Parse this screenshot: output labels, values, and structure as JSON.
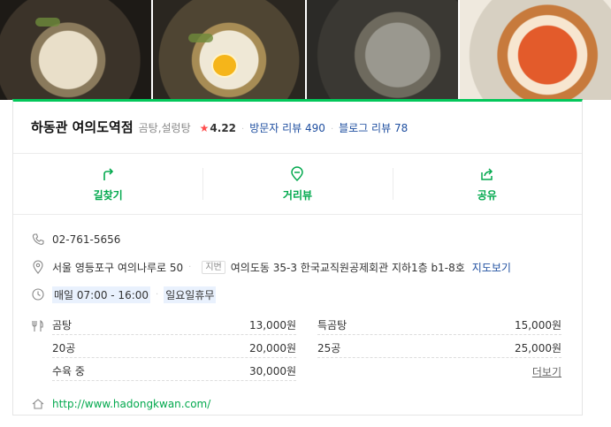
{
  "photos": [
    "food-photo-1",
    "food-photo-2",
    "food-photo-3",
    "food-photo-4"
  ],
  "place": {
    "name": "하동관 여의도역점",
    "category": "곰탕,설렁탕",
    "star": "★",
    "rating": "4.22",
    "visitor_reviews": "방문자 리뷰 490",
    "blog_reviews": "블로그 리뷰 78"
  },
  "actions": [
    {
      "label": "길찾기",
      "icon": "directions-icon"
    },
    {
      "label": "거리뷰",
      "icon": "street-view-icon"
    },
    {
      "label": "공유",
      "icon": "share-icon"
    }
  ],
  "info": {
    "phone": "02-761-5656",
    "address": "서울 영등포구 여의나루로 50",
    "jibun_tag": "지번",
    "jibun": "여의도동 35-3 한국교직원공제회관 지하1층 b1-8호",
    "map_link": "지도보기",
    "hours": "매일 07:00 - 16:00",
    "holiday": "일요일휴무",
    "website": "http://www.hadongkwan.com/"
  },
  "menu": [
    {
      "name": "곰탕",
      "price": "13,000원"
    },
    {
      "name": "특곰탕",
      "price": "15,000원"
    },
    {
      "name": "20공",
      "price": "20,000원"
    },
    {
      "name": "25공",
      "price": "25,000원"
    },
    {
      "name": "수육 중",
      "price": "30,000원"
    }
  ],
  "menu_more": "더보기",
  "colors": {
    "accent": "#03c75a",
    "link": "#1f4fa0",
    "star": "#ff4d4d"
  }
}
